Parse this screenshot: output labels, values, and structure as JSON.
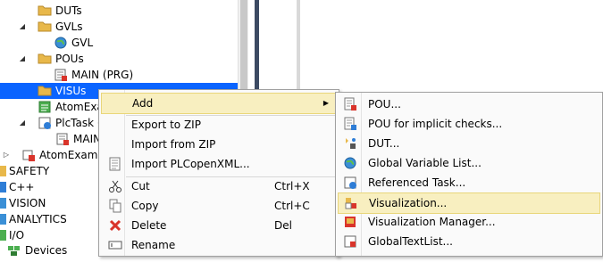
{
  "tree": {
    "items": [
      {
        "label": "DUTs",
        "icon": "folder-icon"
      },
      {
        "label": "GVLs",
        "icon": "folder-icon"
      },
      {
        "label": "GVL",
        "icon": "globe-icon"
      },
      {
        "label": "POUs",
        "icon": "folder-icon"
      },
      {
        "label": "MAIN (PRG)",
        "icon": "program-icon"
      },
      {
        "label": "VISUs",
        "icon": "folder-icon",
        "selected": true
      },
      {
        "label": "AtomExa",
        "icon": "task-config-icon"
      },
      {
        "label": "PlcTask (",
        "icon": "task-icon"
      },
      {
        "label": "MAIN",
        "icon": "program-icon"
      },
      {
        "label": "AtomExamp",
        "icon": "project-icon"
      },
      {
        "label": "SAFETY",
        "icon": "safety-icon"
      },
      {
        "label": "C++",
        "icon": "cpp-icon"
      },
      {
        "label": "VISION",
        "icon": "vision-icon"
      },
      {
        "label": "ANALYTICS",
        "icon": "analytics-icon"
      },
      {
        "label": "I/O",
        "icon": "io-icon"
      },
      {
        "label": "Devices",
        "icon": "devices-icon"
      }
    ]
  },
  "context_menu": {
    "items": [
      {
        "label": "Add",
        "shortcut": "",
        "icon": "",
        "submenu": true,
        "highlighted": true
      },
      {
        "label": "Export to ZIP",
        "shortcut": "",
        "icon": ""
      },
      {
        "label": "Import from ZIP",
        "shortcut": "",
        "icon": ""
      },
      {
        "label": "Import PLCopenXML...",
        "shortcut": "",
        "icon": "import-xml-icon"
      },
      {
        "label": "Cut",
        "shortcut": "Ctrl+X",
        "icon": "scissors-icon"
      },
      {
        "label": "Copy",
        "shortcut": "Ctrl+C",
        "icon": "copy-icon"
      },
      {
        "label": "Delete",
        "shortcut": "Del",
        "icon": "delete-icon"
      },
      {
        "label": "Rename",
        "shortcut": "",
        "icon": "rename-icon"
      }
    ]
  },
  "add_submenu": {
    "items": [
      {
        "label": "POU...",
        "icon": "pou-icon"
      },
      {
        "label": "POU for implicit checks...",
        "icon": "pou-checks-icon"
      },
      {
        "label": "DUT...",
        "icon": "dut-icon"
      },
      {
        "label": "Global Variable List...",
        "icon": "globe-icon"
      },
      {
        "label": "Referenced Task...",
        "icon": "referenced-task-icon"
      },
      {
        "label": "Visualization...",
        "icon": "visualization-icon",
        "highlighted": true
      },
      {
        "label": "Visualization Manager...",
        "icon": "visualization-manager-icon"
      },
      {
        "label": "GlobalTextList...",
        "icon": "text-list-icon"
      }
    ]
  },
  "colors": {
    "selection": "#0a64ff",
    "menu_highlight": "#f8efc0",
    "folder": "#e8b84a",
    "delete": "#d9342b"
  }
}
